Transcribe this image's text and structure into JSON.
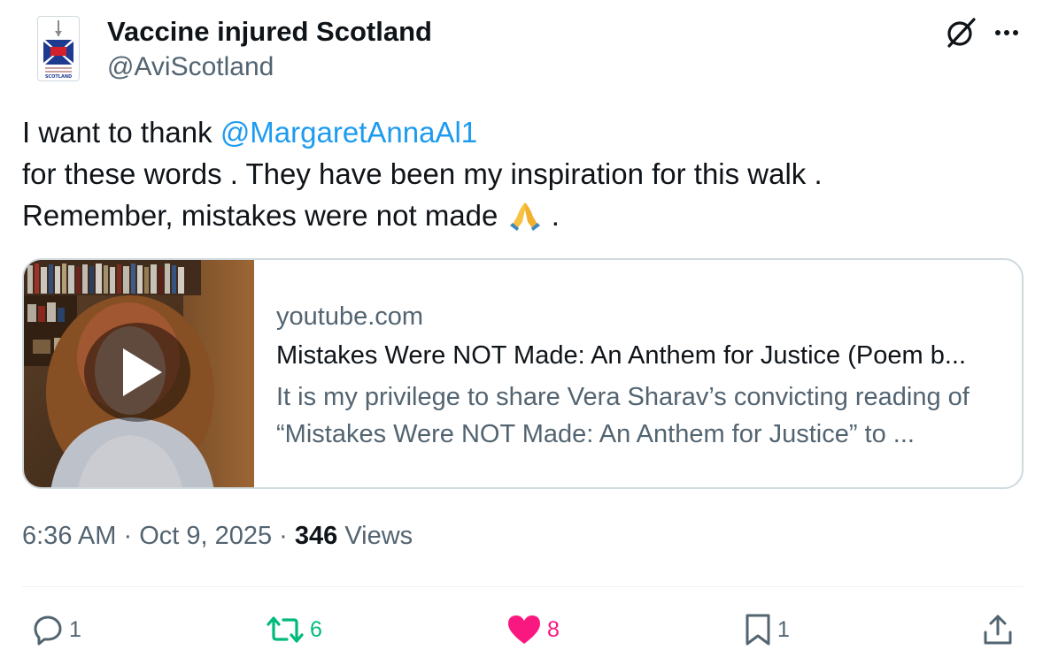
{
  "author": {
    "display_name": "Vaccine injured Scotland",
    "handle": "@AviScotland",
    "avatar_logo_text": "SCOTLAND"
  },
  "post": {
    "text_line1_prefix": "I want to thank ",
    "mention": "@MargaretAnnaAl1",
    "text_line2": "for these words . They have been my inspiration for this walk .",
    "text_line3_prefix": "Remember, mistakes were not made ",
    "text_line3_suffix": " .",
    "emoji": "folded-hands"
  },
  "link_card": {
    "domain": "youtube.com",
    "title": "Mistakes Were NOT Made: An Anthem for Justice (Poem b...",
    "description": "It is my privilege to share Vera Sharav’s convicting reading of “Mistakes Were NOT Made: An Anthem for Justice” to ...",
    "thumbnail_icon": "play-icon"
  },
  "meta": {
    "time": "6:36 AM",
    "separator1": " · ",
    "date": "Oct 9, 2025",
    "separator2": " · ",
    "views_count": "346",
    "views_label": " Views"
  },
  "actions": {
    "replies": "1",
    "reposts": "6",
    "likes": "8",
    "bookmarks": "1"
  },
  "colors": {
    "accent": "#1d9bf0",
    "repost_active": "#00ba7c",
    "like_active": "#f91880",
    "secondary_text": "#536471",
    "primary_text": "#0f1419"
  }
}
